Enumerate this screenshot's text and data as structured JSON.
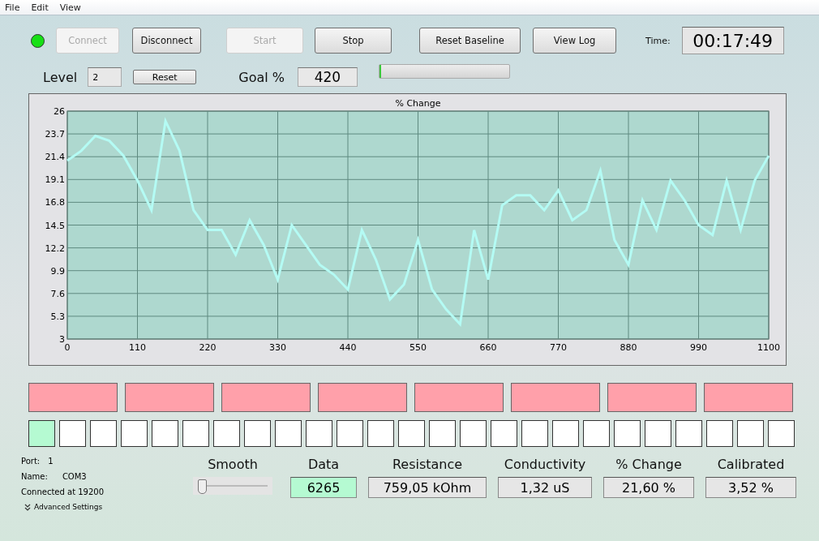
{
  "menu": [
    "File",
    "Edit",
    "View"
  ],
  "status_led": {
    "on": true
  },
  "buttons": [
    {
      "label": "Connect",
      "disabled": true
    },
    {
      "label": "Disconnect",
      "disabled": false
    },
    {
      "label": "Start",
      "disabled": true
    },
    {
      "label": "Stop",
      "disabled": false
    },
    {
      "label": "Reset Baseline",
      "disabled": false
    },
    {
      "label": "View Log",
      "disabled": false
    }
  ],
  "time": {
    "label": "Time:",
    "value": "00:17:49"
  },
  "level": {
    "label": "Level",
    "value": "2",
    "reset_button": "Reset"
  },
  "goal": {
    "label": "Goal %",
    "value": "420",
    "level": 0
  },
  "chart": {
    "chart_data": {
      "type": "line",
      "title": "% Change",
      "x": [
        0,
        22,
        44,
        66,
        88,
        110,
        132,
        154,
        176,
        198,
        220,
        242,
        264,
        286,
        308,
        330,
        352,
        374,
        396,
        418,
        440,
        462,
        484,
        506,
        528,
        550,
        572,
        594,
        616,
        638,
        660,
        682,
        704,
        726,
        748,
        770,
        792,
        814,
        836,
        858,
        880,
        902,
        924,
        946,
        968,
        990,
        1012,
        1034,
        1056,
        1078,
        1100
      ],
      "grid": true,
      "series": [
        {
          "color": "#b4fbf4",
          "values": [
            21,
            22,
            23.5,
            23,
            21.5,
            19,
            16,
            25,
            22,
            16,
            14,
            14,
            11.5,
            15,
            12.5,
            9,
            14.5,
            12.5,
            10.5,
            9.5,
            8,
            14,
            11,
            7,
            8.5,
            13,
            8,
            6,
            4.5,
            14,
            9,
            16.5,
            17.5,
            17.5,
            16,
            18,
            15,
            16,
            20,
            13,
            10.5,
            17,
            14,
            19,
            17,
            14.5,
            13.5,
            19,
            14,
            19,
            21.5
          ]
        }
      ],
      "xlim": [
        0,
        1100
      ],
      "ylim": [
        3,
        26
      ],
      "xticks": [
        0,
        110,
        220,
        330,
        440,
        550,
        660,
        770,
        880,
        990,
        1100
      ],
      "yticks": [
        3,
        5.3,
        7.6,
        9.9,
        12.2,
        14.5,
        16.8,
        19.1,
        21.4,
        23.7,
        26
      ]
    }
  },
  "zones": [
    {
      "on": false
    },
    {
      "on": false
    },
    {
      "on": false
    },
    {
      "on": false
    },
    {
      "on": false
    },
    {
      "on": false
    },
    {
      "on": false
    },
    {
      "on": false
    }
  ],
  "cells": [
    {
      "on": true
    },
    {
      "on": false
    },
    {
      "on": false
    },
    {
      "on": false
    },
    {
      "on": false
    },
    {
      "on": false
    },
    {
      "on": false
    },
    {
      "on": false
    },
    {
      "on": false
    },
    {
      "on": false
    },
    {
      "on": false
    },
    {
      "on": false
    },
    {
      "on": false
    },
    {
      "on": false
    },
    {
      "on": false
    },
    {
      "on": false
    },
    {
      "on": false
    },
    {
      "on": false
    },
    {
      "on": false
    },
    {
      "on": false
    },
    {
      "on": false
    },
    {
      "on": false
    },
    {
      "on": false
    },
    {
      "on": false
    },
    {
      "on": false
    }
  ],
  "connection": {
    "port_label": "Port:",
    "port": "1",
    "name_label": "Name:",
    "name": "COM3",
    "status": "Connected at 19200",
    "advanced": "Advanced Settings"
  },
  "smooth": {
    "label": "Smooth",
    "level": 0
  },
  "readouts": [
    {
      "label": "Data",
      "value": "6265",
      "highlighted": true
    },
    {
      "label": "Resistance",
      "value": "759,05 kOhm",
      "highlighted": false
    },
    {
      "label": "Conductivity",
      "value": "1,32 uS",
      "highlighted": false
    },
    {
      "label": "% Change",
      "value": "21,60 %",
      "highlighted": false
    },
    {
      "label": "Calibrated",
      "value": "3,52 %",
      "highlighted": false
    }
  ]
}
